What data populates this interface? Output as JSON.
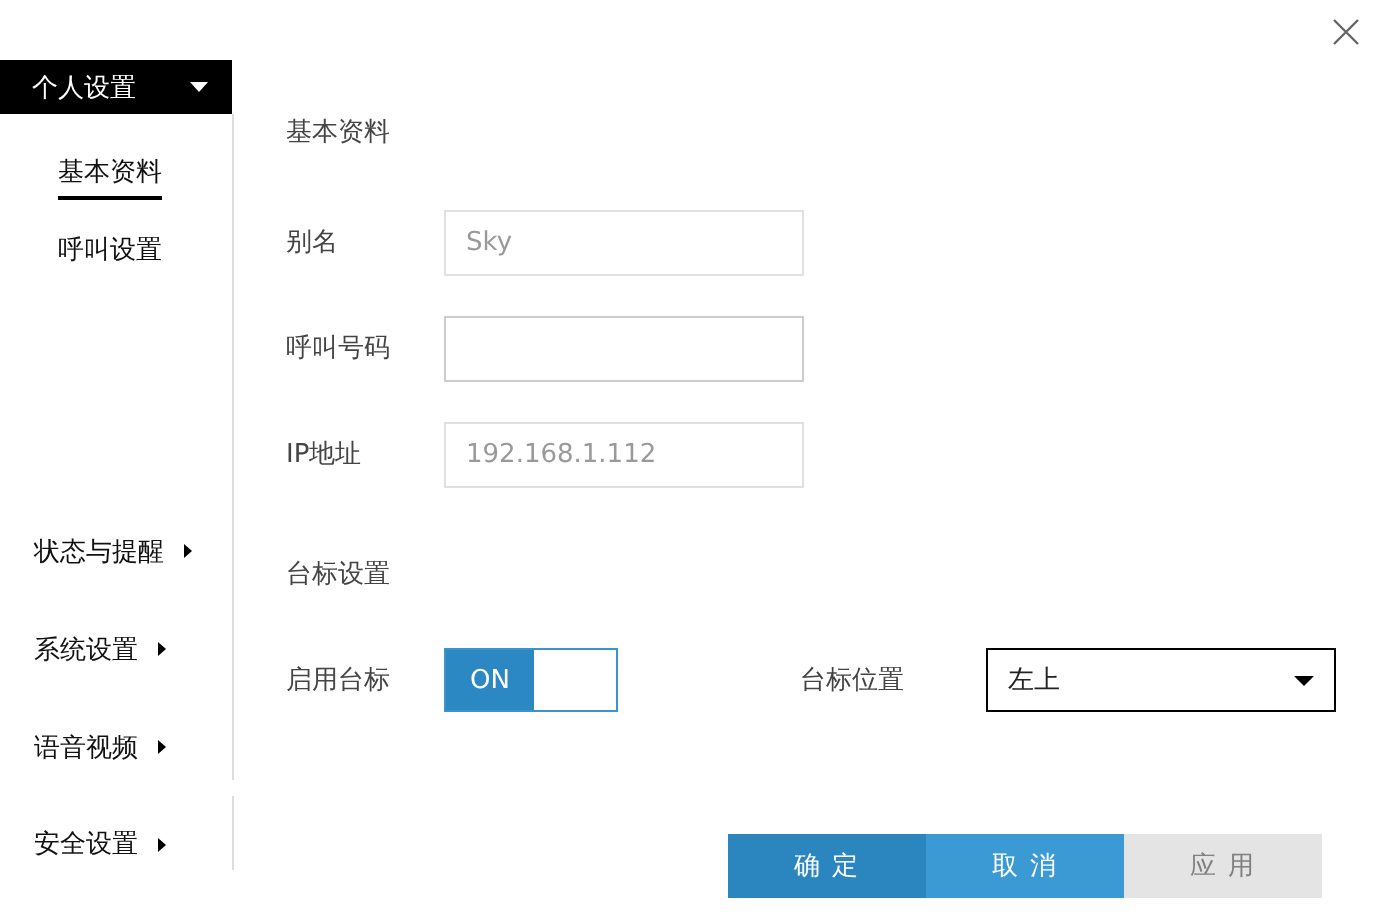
{
  "header": {
    "title": "个人设置",
    "expanded": true
  },
  "sub_items": [
    {
      "label": "基本资料",
      "selected": true
    },
    {
      "label": "呼叫设置",
      "selected": false
    }
  ],
  "menu_items": [
    {
      "label": "状态与提醒"
    },
    {
      "label": "系统设置"
    },
    {
      "label": "语音视频"
    },
    {
      "label": "安全设置"
    }
  ],
  "section_title": "基本资料",
  "fields": [
    {
      "label": "别名",
      "value": "Sky",
      "disabled": true
    },
    {
      "label": "呼叫号码",
      "disabled": false
    },
    {
      "label": "IP地址",
      "value": "192.168.1.112",
      "disabled": true
    }
  ],
  "logo_section": "台标设置",
  "logo_toggle": {
    "label": "启用台标",
    "text": "ON",
    "on": true
  },
  "logo_position": {
    "label": "台标位置",
    "value": "左上"
  },
  "buttons": [
    {
      "label": "确 定",
      "kind": "primary",
      "disabled": false
    },
    {
      "label": "取 消",
      "kind": "secondary",
      "disabled": false
    },
    {
      "label": "应 用",
      "kind": "secondary",
      "disabled": true
    }
  ]
}
